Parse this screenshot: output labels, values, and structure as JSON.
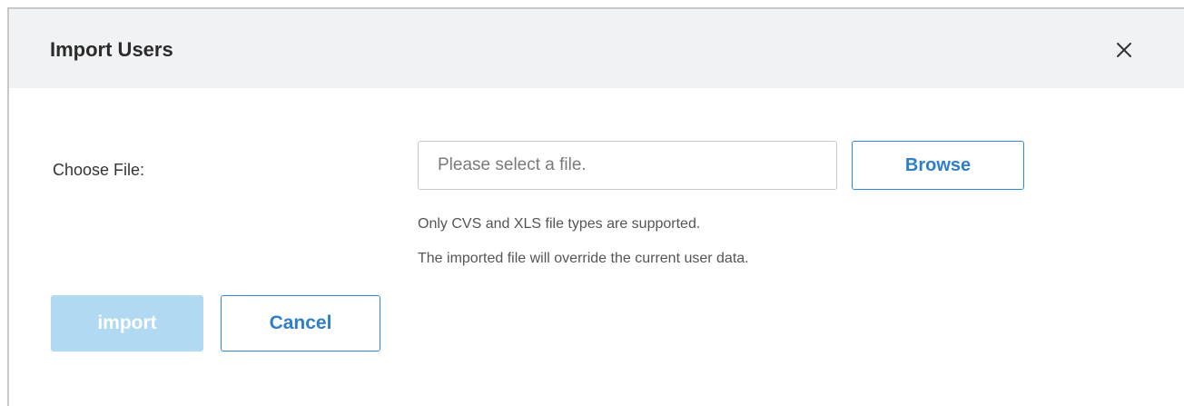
{
  "dialog": {
    "title": "Import Users",
    "close_icon": "close-icon"
  },
  "form": {
    "choose_file_label": "Choose File:",
    "file_input": {
      "value": "",
      "placeholder": "Please select a file."
    },
    "browse_label": "Browse",
    "hints": [
      "Only CVS and XLS file types are supported.",
      "The imported file will override the current user data."
    ]
  },
  "actions": {
    "import_label": "import",
    "import_enabled": false,
    "cancel_label": "Cancel"
  },
  "colors": {
    "accent": "#2e7fcb",
    "accent_border": "#2e8ad8",
    "disabled_button": "#b1d9f1",
    "header_background": "#f1f2f4",
    "title_text": "#2b2b2b",
    "hint_text": "#555555"
  }
}
